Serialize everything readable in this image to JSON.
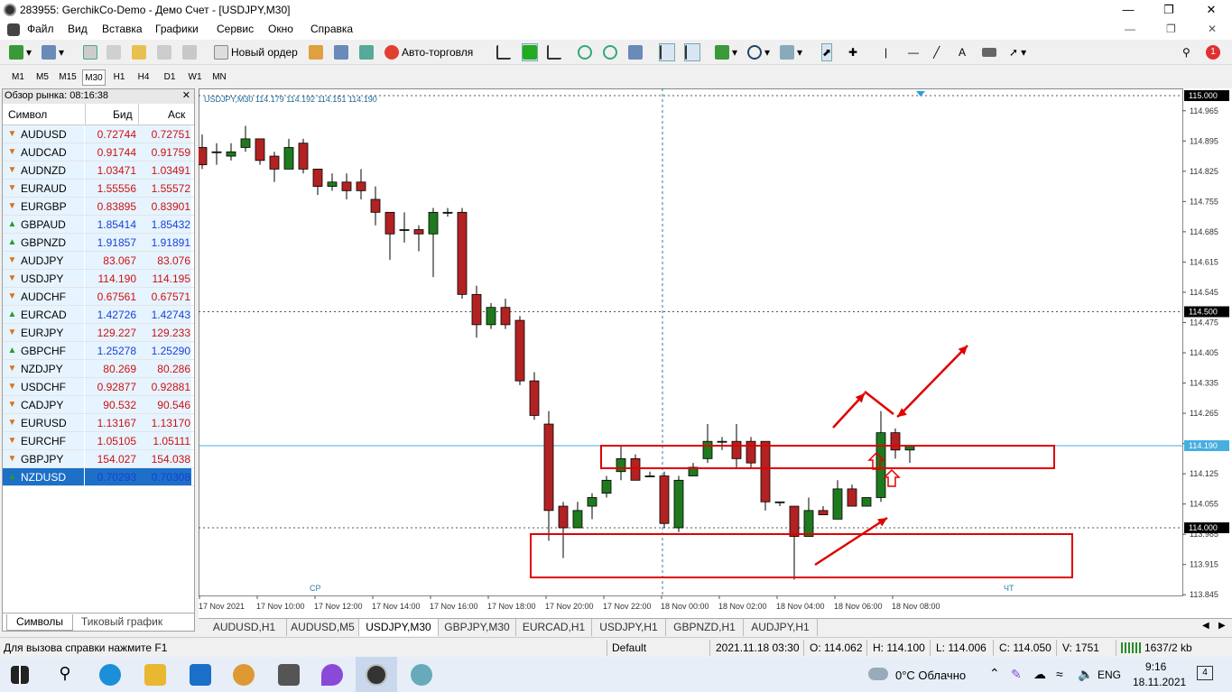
{
  "window": {
    "title": "283955: GerchikCo-Demo - Демо Счет - [USDJPY,M30]"
  },
  "menu": [
    "Файл",
    "Вид",
    "Вставка",
    "Графики",
    "Сервис",
    "Окно",
    "Справка"
  ],
  "toolbar": {
    "new_order": "Новый ордер",
    "auto_trading": "Авто-торговля",
    "notification_count": "1"
  },
  "timeframes": [
    "M1",
    "M5",
    "M15",
    "M30",
    "H1",
    "H4",
    "D1",
    "W1",
    "MN"
  ],
  "market_watch": {
    "title": "Обзор рынка: 08:16:38",
    "col_symbol": "Символ",
    "col_bid": "Бид",
    "col_ask": "Аск",
    "rows": [
      {
        "symbol": "AUDUSD",
        "bid": "0.72744",
        "ask": "0.72751",
        "dir": "down"
      },
      {
        "symbol": "AUDCAD",
        "bid": "0.91744",
        "ask": "0.91759",
        "dir": "down"
      },
      {
        "symbol": "AUDNZD",
        "bid": "1.03471",
        "ask": "1.03491",
        "dir": "down"
      },
      {
        "symbol": "EURAUD",
        "bid": "1.55556",
        "ask": "1.55572",
        "dir": "down"
      },
      {
        "symbol": "EURGBP",
        "bid": "0.83895",
        "ask": "0.83901",
        "dir": "down"
      },
      {
        "symbol": "GBPAUD",
        "bid": "1.85414",
        "ask": "1.85432",
        "dir": "up"
      },
      {
        "symbol": "GBPNZD",
        "bid": "1.91857",
        "ask": "1.91891",
        "dir": "up"
      },
      {
        "symbol": "AUDJPY",
        "bid": "83.067",
        "ask": "83.076",
        "dir": "down"
      },
      {
        "symbol": "USDJPY",
        "bid": "114.190",
        "ask": "114.195",
        "dir": "down"
      },
      {
        "symbol": "AUDCHF",
        "bid": "0.67561",
        "ask": "0.67571",
        "dir": "down"
      },
      {
        "symbol": "EURCAD",
        "bid": "1.42726",
        "ask": "1.42743",
        "dir": "up"
      },
      {
        "symbol": "EURJPY",
        "bid": "129.227",
        "ask": "129.233",
        "dir": "down"
      },
      {
        "symbol": "GBPCHF",
        "bid": "1.25278",
        "ask": "1.25290",
        "dir": "up"
      },
      {
        "symbol": "NZDJPY",
        "bid": "80.269",
        "ask": "80.286",
        "dir": "down"
      },
      {
        "symbol": "USDCHF",
        "bid": "0.92877",
        "ask": "0.92881",
        "dir": "down"
      },
      {
        "symbol": "CADJPY",
        "bid": "90.532",
        "ask": "90.546",
        "dir": "down"
      },
      {
        "symbol": "EURUSD",
        "bid": "1.13167",
        "ask": "1.13170",
        "dir": "down"
      },
      {
        "symbol": "EURCHF",
        "bid": "1.05105",
        "ask": "1.05111",
        "dir": "down"
      },
      {
        "symbol": "GBPJPY",
        "bid": "154.027",
        "ask": "154.038",
        "dir": "down"
      },
      {
        "symbol": "NZDUSD",
        "bid": "0.70293",
        "ask": "0.70308",
        "dir": "up",
        "selected": true
      }
    ],
    "tabs": [
      "Символы",
      "Тиковый график"
    ]
  },
  "chart": {
    "header": "USDJPY,M30  114.179 114.192 114.151 114.190",
    "price_ticks": [
      "114.965",
      "114.895",
      "114.825",
      "114.755",
      "114.685",
      "114.615",
      "114.545",
      "114.475",
      "114.405",
      "114.335",
      "114.265",
      "114.195",
      "114.125",
      "114.055",
      "113.985",
      "113.915",
      "113.845"
    ],
    "level_labels": [
      "115.000",
      "114.500",
      "114.190",
      "114.000"
    ],
    "time_labels": [
      "17 Nov 2021",
      "17 Nov 10:00",
      "17 Nov 12:00",
      "17 Nov 14:00",
      "17 Nov 16:00",
      "17 Nov 18:00",
      "17 Nov 20:00",
      "17 Nov 22:00",
      "18 Nov 00:00",
      "18 Nov 02:00",
      "18 Nov 04:00",
      "18 Nov 06:00",
      "18 Nov 08:00"
    ],
    "day_labels": [
      "СР",
      "ЧТ"
    ],
    "colors": {
      "bull": "#1e7a1e",
      "bear": "#b22222",
      "annotation": "#e00000",
      "bid_line": "#46aee0"
    }
  },
  "chart_data": {
    "type": "candlestick",
    "symbol": "USDJPY",
    "timeframe": "M30",
    "ylim": [
      113.83,
      115.0
    ],
    "horizontal_levels": [
      115.0,
      114.5,
      114.19,
      114.0
    ],
    "candles": [
      {
        "o": 114.88,
        "h": 114.91,
        "l": 114.83,
        "c": 114.84
      },
      {
        "o": 114.87,
        "h": 114.89,
        "l": 114.84,
        "c": 114.87
      },
      {
        "o": 114.86,
        "h": 114.89,
        "l": 114.85,
        "c": 114.87
      },
      {
        "o": 114.88,
        "h": 114.93,
        "l": 114.87,
        "c": 114.9
      },
      {
        "o": 114.9,
        "h": 114.9,
        "l": 114.84,
        "c": 114.85
      },
      {
        "o": 114.86,
        "h": 114.87,
        "l": 114.8,
        "c": 114.83
      },
      {
        "o": 114.83,
        "h": 114.9,
        "l": 114.83,
        "c": 114.88
      },
      {
        "o": 114.89,
        "h": 114.9,
        "l": 114.82,
        "c": 114.83
      },
      {
        "o": 114.83,
        "h": 114.83,
        "l": 114.77,
        "c": 114.79
      },
      {
        "o": 114.79,
        "h": 114.82,
        "l": 114.78,
        "c": 114.8
      },
      {
        "o": 114.8,
        "h": 114.82,
        "l": 114.76,
        "c": 114.78
      },
      {
        "o": 114.8,
        "h": 114.83,
        "l": 114.76,
        "c": 114.78
      },
      {
        "o": 114.76,
        "h": 114.79,
        "l": 114.7,
        "c": 114.73
      },
      {
        "o": 114.73,
        "h": 114.73,
        "l": 114.62,
        "c": 114.68
      },
      {
        "o": 114.69,
        "h": 114.73,
        "l": 114.66,
        "c": 114.69
      },
      {
        "o": 114.69,
        "h": 114.7,
        "l": 114.64,
        "c": 114.68
      },
      {
        "o": 114.68,
        "h": 114.74,
        "l": 114.58,
        "c": 114.73
      },
      {
        "o": 114.73,
        "h": 114.74,
        "l": 114.72,
        "c": 114.73
      },
      {
        "o": 114.73,
        "h": 114.74,
        "l": 114.53,
        "c": 114.54
      },
      {
        "o": 114.54,
        "h": 114.56,
        "l": 114.44,
        "c": 114.47
      },
      {
        "o": 114.47,
        "h": 114.52,
        "l": 114.46,
        "c": 114.51
      },
      {
        "o": 114.51,
        "h": 114.53,
        "l": 114.46,
        "c": 114.47
      },
      {
        "o": 114.48,
        "h": 114.49,
        "l": 114.33,
        "c": 114.34
      },
      {
        "o": 114.34,
        "h": 114.36,
        "l": 114.25,
        "c": 114.26
      },
      {
        "o": 114.24,
        "h": 114.27,
        "l": 113.97,
        "c": 114.04
      },
      {
        "o": 114.05,
        "h": 114.06,
        "l": 113.93,
        "c": 114.0
      },
      {
        "o": 114.0,
        "h": 114.06,
        "l": 114.0,
        "c": 114.04
      },
      {
        "o": 114.05,
        "h": 114.08,
        "l": 114.02,
        "c": 114.07
      },
      {
        "o": 114.08,
        "h": 114.12,
        "l": 114.07,
        "c": 114.11
      },
      {
        "o": 114.13,
        "h": 114.19,
        "l": 114.11,
        "c": 114.16
      },
      {
        "o": 114.16,
        "h": 114.17,
        "l": 114.11,
        "c": 114.11
      },
      {
        "o": 114.12,
        "h": 114.13,
        "l": 114.12,
        "c": 114.12
      },
      {
        "o": 114.12,
        "h": 114.13,
        "l": 114.0,
        "c": 114.01
      },
      {
        "o": 114.0,
        "h": 114.12,
        "l": 113.99,
        "c": 114.11
      },
      {
        "o": 114.12,
        "h": 114.15,
        "l": 114.12,
        "c": 114.14
      },
      {
        "o": 114.16,
        "h": 114.24,
        "l": 114.15,
        "c": 114.2
      },
      {
        "o": 114.2,
        "h": 114.21,
        "l": 114.18,
        "c": 114.2
      },
      {
        "o": 114.2,
        "h": 114.24,
        "l": 114.14,
        "c": 114.16
      },
      {
        "o": 114.2,
        "h": 114.21,
        "l": 114.14,
        "c": 114.15
      },
      {
        "o": 114.2,
        "h": 114.2,
        "l": 114.04,
        "c": 114.06
      },
      {
        "o": 114.06,
        "h": 114.06,
        "l": 114.05,
        "c": 114.06
      },
      {
        "o": 114.05,
        "h": 114.05,
        "l": 113.88,
        "c": 113.98
      },
      {
        "o": 113.98,
        "h": 114.07,
        "l": 113.98,
        "c": 114.04
      },
      {
        "o": 114.04,
        "h": 114.05,
        "l": 114.03,
        "c": 114.03
      },
      {
        "o": 114.02,
        "h": 114.11,
        "l": 114.02,
        "c": 114.09
      },
      {
        "o": 114.09,
        "h": 114.1,
        "l": 114.05,
        "c": 114.05
      },
      {
        "o": 114.05,
        "h": 114.07,
        "l": 114.05,
        "c": 114.07
      },
      {
        "o": 114.07,
        "h": 114.27,
        "l": 114.06,
        "c": 114.22
      },
      {
        "o": 114.22,
        "h": 114.23,
        "l": 114.16,
        "c": 114.18
      },
      {
        "o": 114.18,
        "h": 114.19,
        "l": 114.15,
        "c": 114.19
      }
    ]
  },
  "chart_tabs": [
    "AUDUSD,H1",
    "AUDUSD,M5",
    "USDJPY,M30",
    "GBPJPY,M30",
    "EURCAD,H1",
    "USDJPY,H1",
    "GBPNZD,H1",
    "AUDJPY,H1"
  ],
  "status": {
    "help": "Для вызова справки нажмите F1",
    "profile": "Default",
    "datetime": "2021.11.18 03:30",
    "open": "O: 114.062",
    "high": "H: 114.100",
    "low": "L: 114.006",
    "close": "C: 114.050",
    "volume": "V: 1751",
    "traffic": "1637/2 kb"
  },
  "taskbar": {
    "weather": "0°C  Облачно",
    "lang": "ENG",
    "time": "9:16",
    "date": "18.11.2021",
    "badge": "4"
  }
}
